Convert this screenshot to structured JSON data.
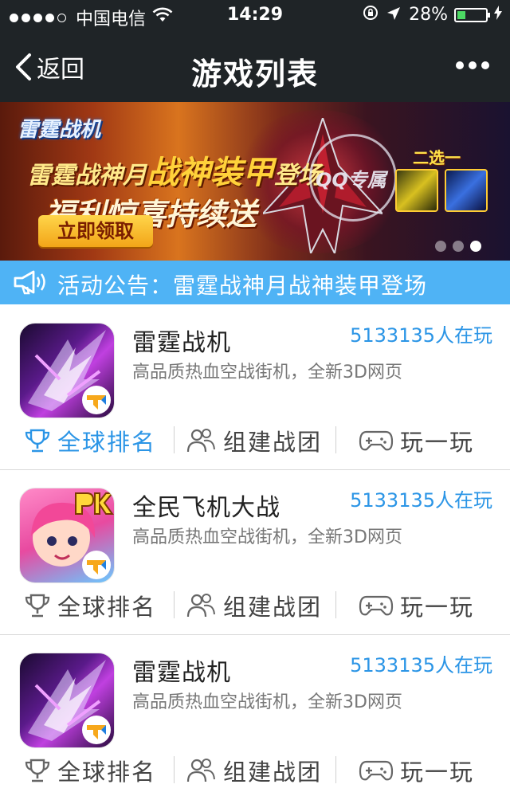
{
  "status_bar": {
    "carrier": "中国电信",
    "time": "14:29",
    "battery": "28%"
  },
  "nav": {
    "back_label": "返回",
    "title": "游戏列表"
  },
  "banner": {
    "brand": "雷霆战机",
    "line1_prefix": "雷霆战神月",
    "line1_big": "战神装甲",
    "line1_suffix": "登场",
    "line2": "福利惊喜持续送",
    "cta_label": "立即领取",
    "stamp_text": "QQ专属",
    "choose_label": "二选一",
    "pager_total": 3,
    "pager_active": 3
  },
  "notice": {
    "text": "活动公告：雷霆战神月战神装甲登场"
  },
  "games": [
    {
      "name": "雷霆战机",
      "players": "5133135人在玩",
      "desc": "高品质热血空战街机，全新3D网页",
      "actions": [
        "全球排名",
        "组建战团",
        "玩一玩"
      ],
      "active_action": 0,
      "icon": "thunder-fighter-icon"
    },
    {
      "name": "全民飞机大战",
      "players": "5133135人在玩",
      "desc": "高品质热血空战街机，全新3D网页",
      "actions": [
        "全球排名",
        "组建战团",
        "玩一玩"
      ],
      "active_action": -1,
      "icon": "pk-girl-icon"
    },
    {
      "name": "雷霆战机",
      "players": "5133135人在玩",
      "desc": "高品质热血空战街机，全新3D网页",
      "actions": [
        "全球排名",
        "组建战团",
        "玩一玩"
      ],
      "active_action": -1,
      "icon": "thunder-fighter-icon"
    }
  ],
  "colors": {
    "nav_bg": "#1f2427",
    "accent": "#2b95e6",
    "notice_bg": "#4fb3f5"
  }
}
